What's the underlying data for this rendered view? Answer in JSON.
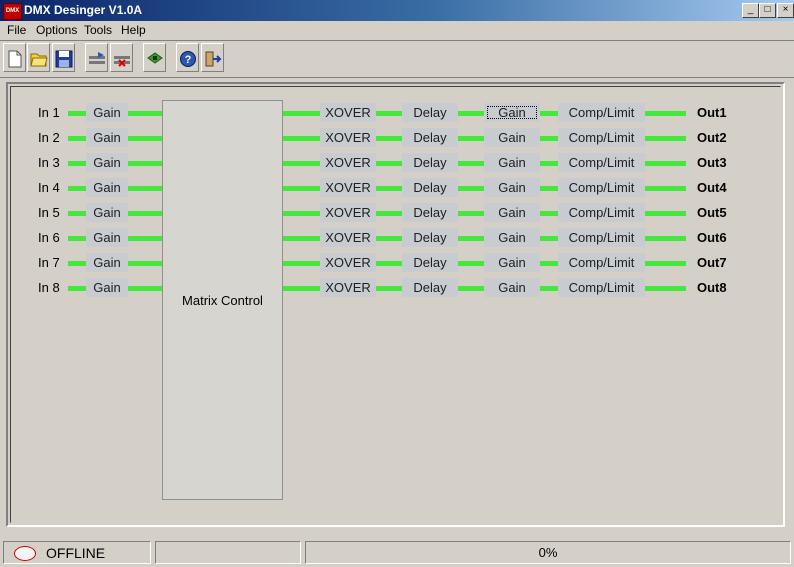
{
  "window": {
    "title": "DMX Desinger V1.0A",
    "icon_text": "DMX",
    "minimize": "_",
    "maximize": "□",
    "close": "×"
  },
  "menu": [
    "File",
    "Options",
    "Tools",
    "Help"
  ],
  "toolbar": [
    "new-file-icon",
    "open-folder-icon",
    "save-icon",
    "device-settings-icon",
    "device-settings-2-icon",
    "chip-icon",
    "help-icon",
    "exit-icon"
  ],
  "channels": {
    "inputs": [
      "In 1",
      "In 2",
      "In 3",
      "In 4",
      "In 5",
      "In 6",
      "In 7",
      "In 8"
    ],
    "outputs": [
      "Out1",
      "Out2",
      "Out3",
      "Out4",
      "Out5",
      "Out6",
      "Out7",
      "Out8"
    ],
    "in_gain": "Gain",
    "xover": "XOVER",
    "delay": "Delay",
    "out_gain": "Gain",
    "comp_limit": "Comp/Limit",
    "matrix": "Matrix Control"
  },
  "status": {
    "connection": "OFFLINE",
    "middle": "",
    "progress": "0%"
  },
  "colors": {
    "signal_line": "#44e83c",
    "block": "#c8ccd0",
    "title_start": "#0a246a"
  }
}
